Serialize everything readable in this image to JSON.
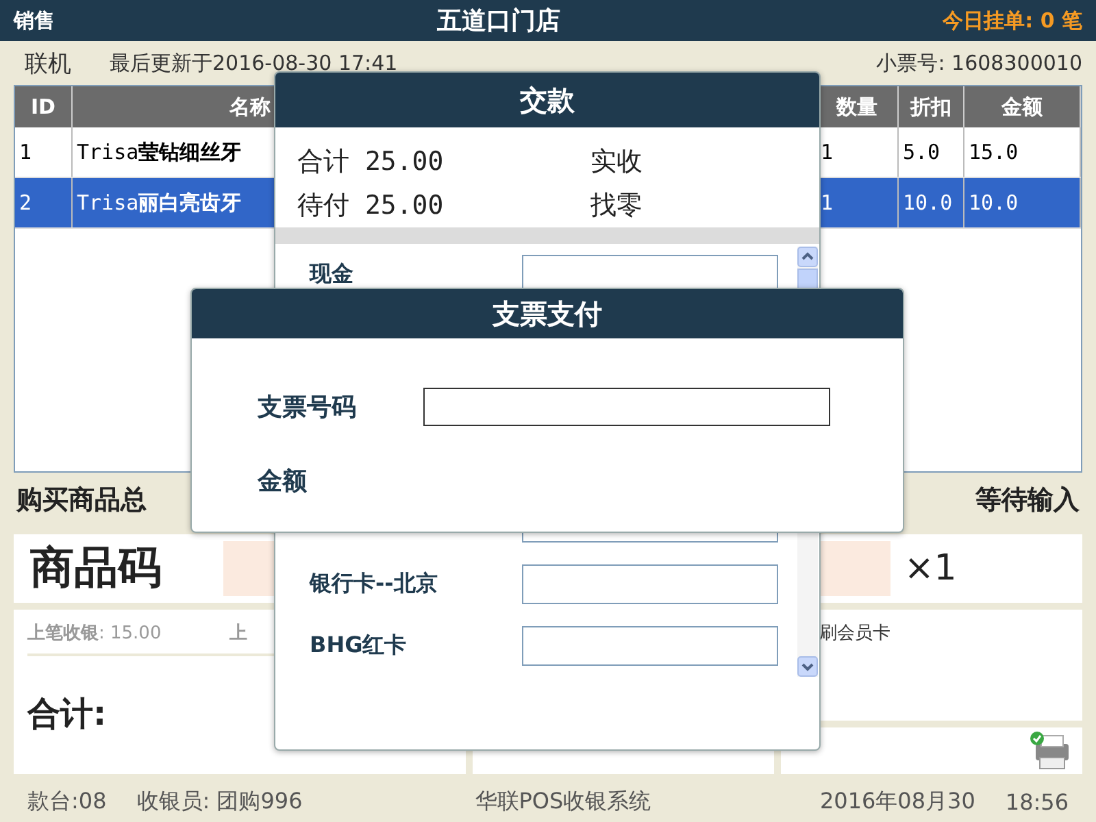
{
  "top_bar": {
    "mode": "销售",
    "store": "五道口门店",
    "pending": "今日挂单: 0 笔"
  },
  "info_bar": {
    "status": "联机",
    "last_update": "最后更新于2016-08-30 17:41",
    "receipt": "小票号: 1608300010"
  },
  "table": {
    "columns": [
      "ID",
      "名称",
      "数量",
      "折扣",
      "金额"
    ],
    "rows": [
      {
        "cells": [
          "1",
          "Trisa**莹钻细丝牙**",
          "1",
          "5.0",
          "15.0"
        ],
        "selected": false
      },
      {
        "cells": [
          "2",
          "Trisa**丽白亮齿牙**",
          "1",
          "10.0",
          "10.0"
        ],
        "selected": true
      }
    ]
  },
  "summary": {
    "label": "购买商品总",
    "status": "等待输入"
  },
  "code_entry": {
    "label": "商品码",
    "quantity": "×1"
  },
  "last_sale": {
    "label": "上笔收银",
    "value": ": 15.00",
    "next_label": "上"
  },
  "total_label": "合计:",
  "member_hint": "刷会员卡",
  "footer": {
    "counter": "款台:08",
    "cashier": "收银员: 团购996",
    "system": "华联POS收银系统",
    "date": "2016年08月30",
    "time": "18:56"
  },
  "payment_dialog": {
    "title": "交款",
    "total": "合计 25.00",
    "received": "实收",
    "due": "待付 25.00",
    "change": "找零",
    "methods": [
      {
        "kind": "labeled",
        "label": "现金"
      },
      {
        "kind": "field_only"
      },
      {
        "kind": "labeled",
        "label": "银行卡--北京"
      },
      {
        "kind": "labeled",
        "label": "BHG红卡"
      }
    ]
  },
  "cheque_dialog": {
    "title": "支票支付",
    "fields": [
      {
        "kind": "input",
        "label": "支票号码"
      },
      {
        "kind": "label_only",
        "label": "金额"
      }
    ]
  }
}
